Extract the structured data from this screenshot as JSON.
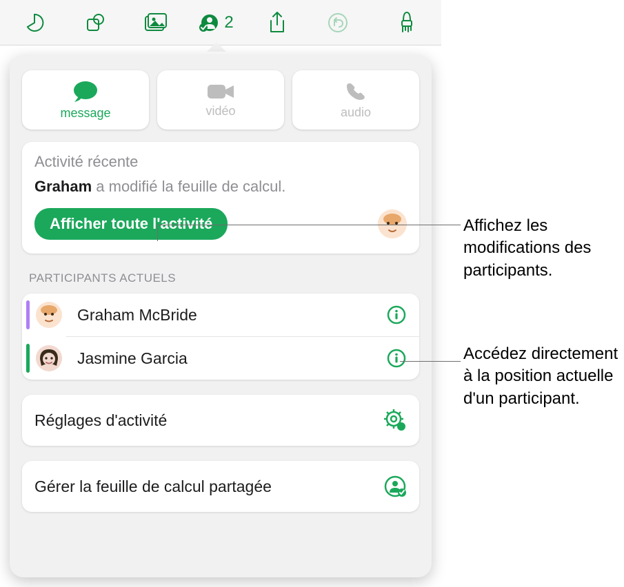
{
  "toolbar": {
    "collab_count": "2"
  },
  "contact": {
    "message": "message",
    "video": "vidéo",
    "audio": "audio"
  },
  "activity": {
    "heading": "Activité récente",
    "actor": "Graham",
    "verb": " a modifié la feuille de calcul.",
    "show_all": "Afficher toute l'activité"
  },
  "participants": {
    "section_label": "PARTICIPANTS ACTUELS",
    "list": [
      {
        "name": "Graham McBride",
        "color": "#b07ff5"
      },
      {
        "name": "Jasmine Garcia",
        "color": "#1ba85b"
      }
    ]
  },
  "settings": {
    "activity_settings": "Réglages d'activité",
    "manage_shared": "Gérer la feuille de calcul partagée"
  },
  "callouts": {
    "c1": "Affichez les modifications des participants.",
    "c2": "Accédez directement à la position actuelle d'un participant."
  },
  "colors": {
    "accent": "#1ba85b"
  }
}
